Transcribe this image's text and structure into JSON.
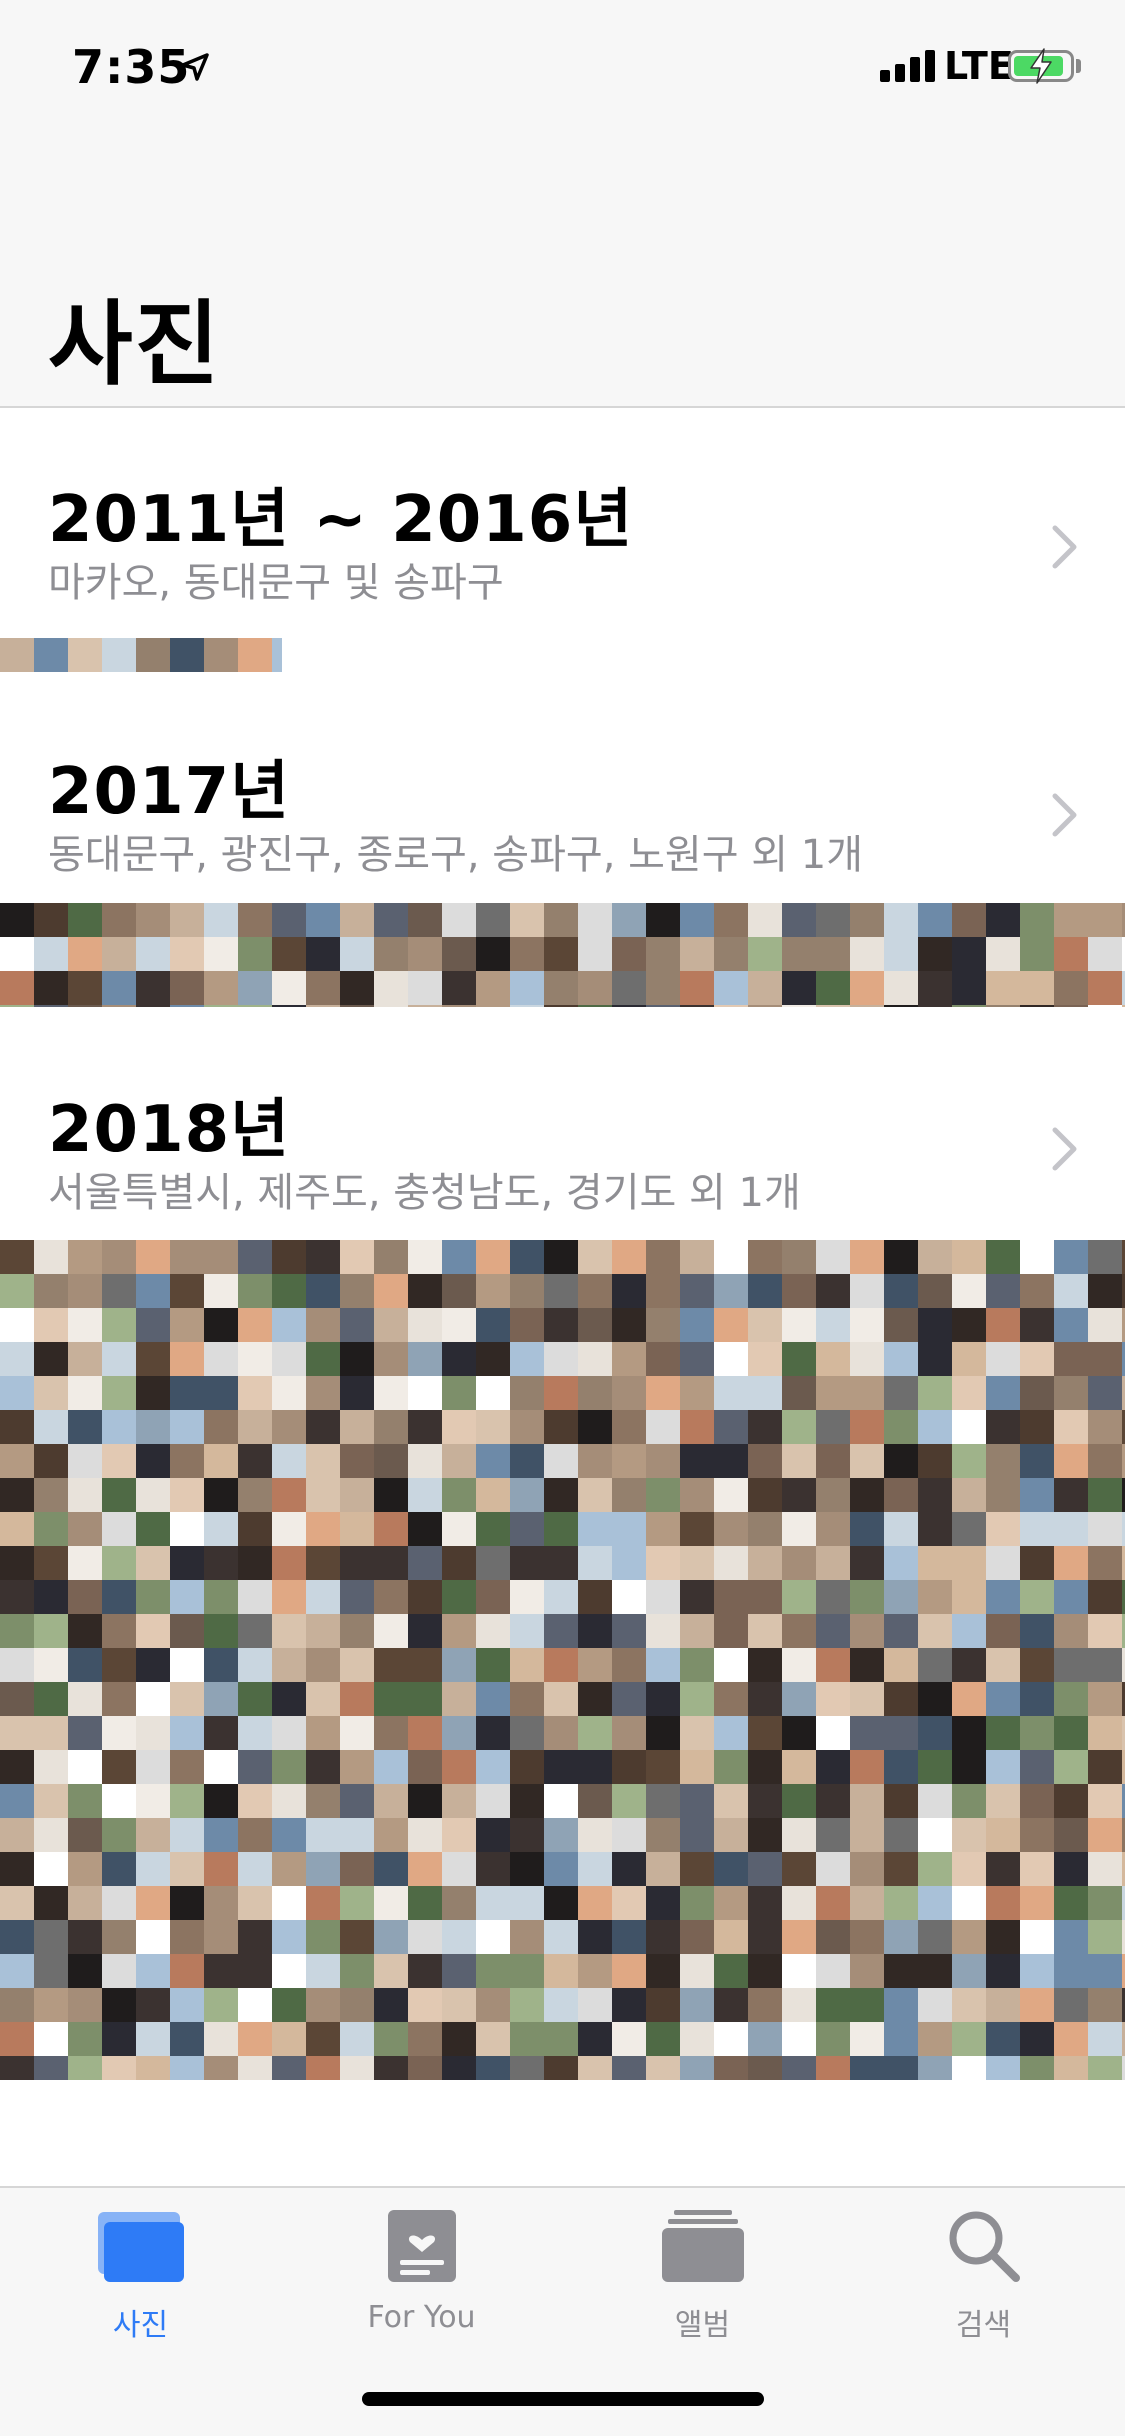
{
  "status_bar": {
    "time": "7:35",
    "network": "LTE",
    "signal_bars": 4,
    "battery_level": 0.9,
    "battery_color": "#4cd964",
    "charging": true
  },
  "header": {
    "title": "사진"
  },
  "sections": [
    {
      "title": "2011년 ~ 2016년",
      "subtitle": "마카오, 동대문구 및 송파구"
    },
    {
      "title": "2017년",
      "subtitle": "동대문구, 광진구, 종로구, 송파구, 노원구 외 1개"
    },
    {
      "title": "2018년",
      "subtitle": "서울특별시, 제주도, 충청남도, 경기도 외 1개"
    }
  ],
  "tabs": [
    {
      "label": "사진",
      "icon": "photos-icon",
      "active": true
    },
    {
      "label": "For You",
      "icon": "for-you-icon",
      "active": false
    },
    {
      "label": "앨범",
      "icon": "albums-icon",
      "active": false
    },
    {
      "label": "검색",
      "icon": "search-icon",
      "active": false
    }
  ],
  "colors": {
    "accent": "#2e7bf6",
    "inactive": "#8e8e93",
    "bar_background": "#f7f7f7"
  }
}
